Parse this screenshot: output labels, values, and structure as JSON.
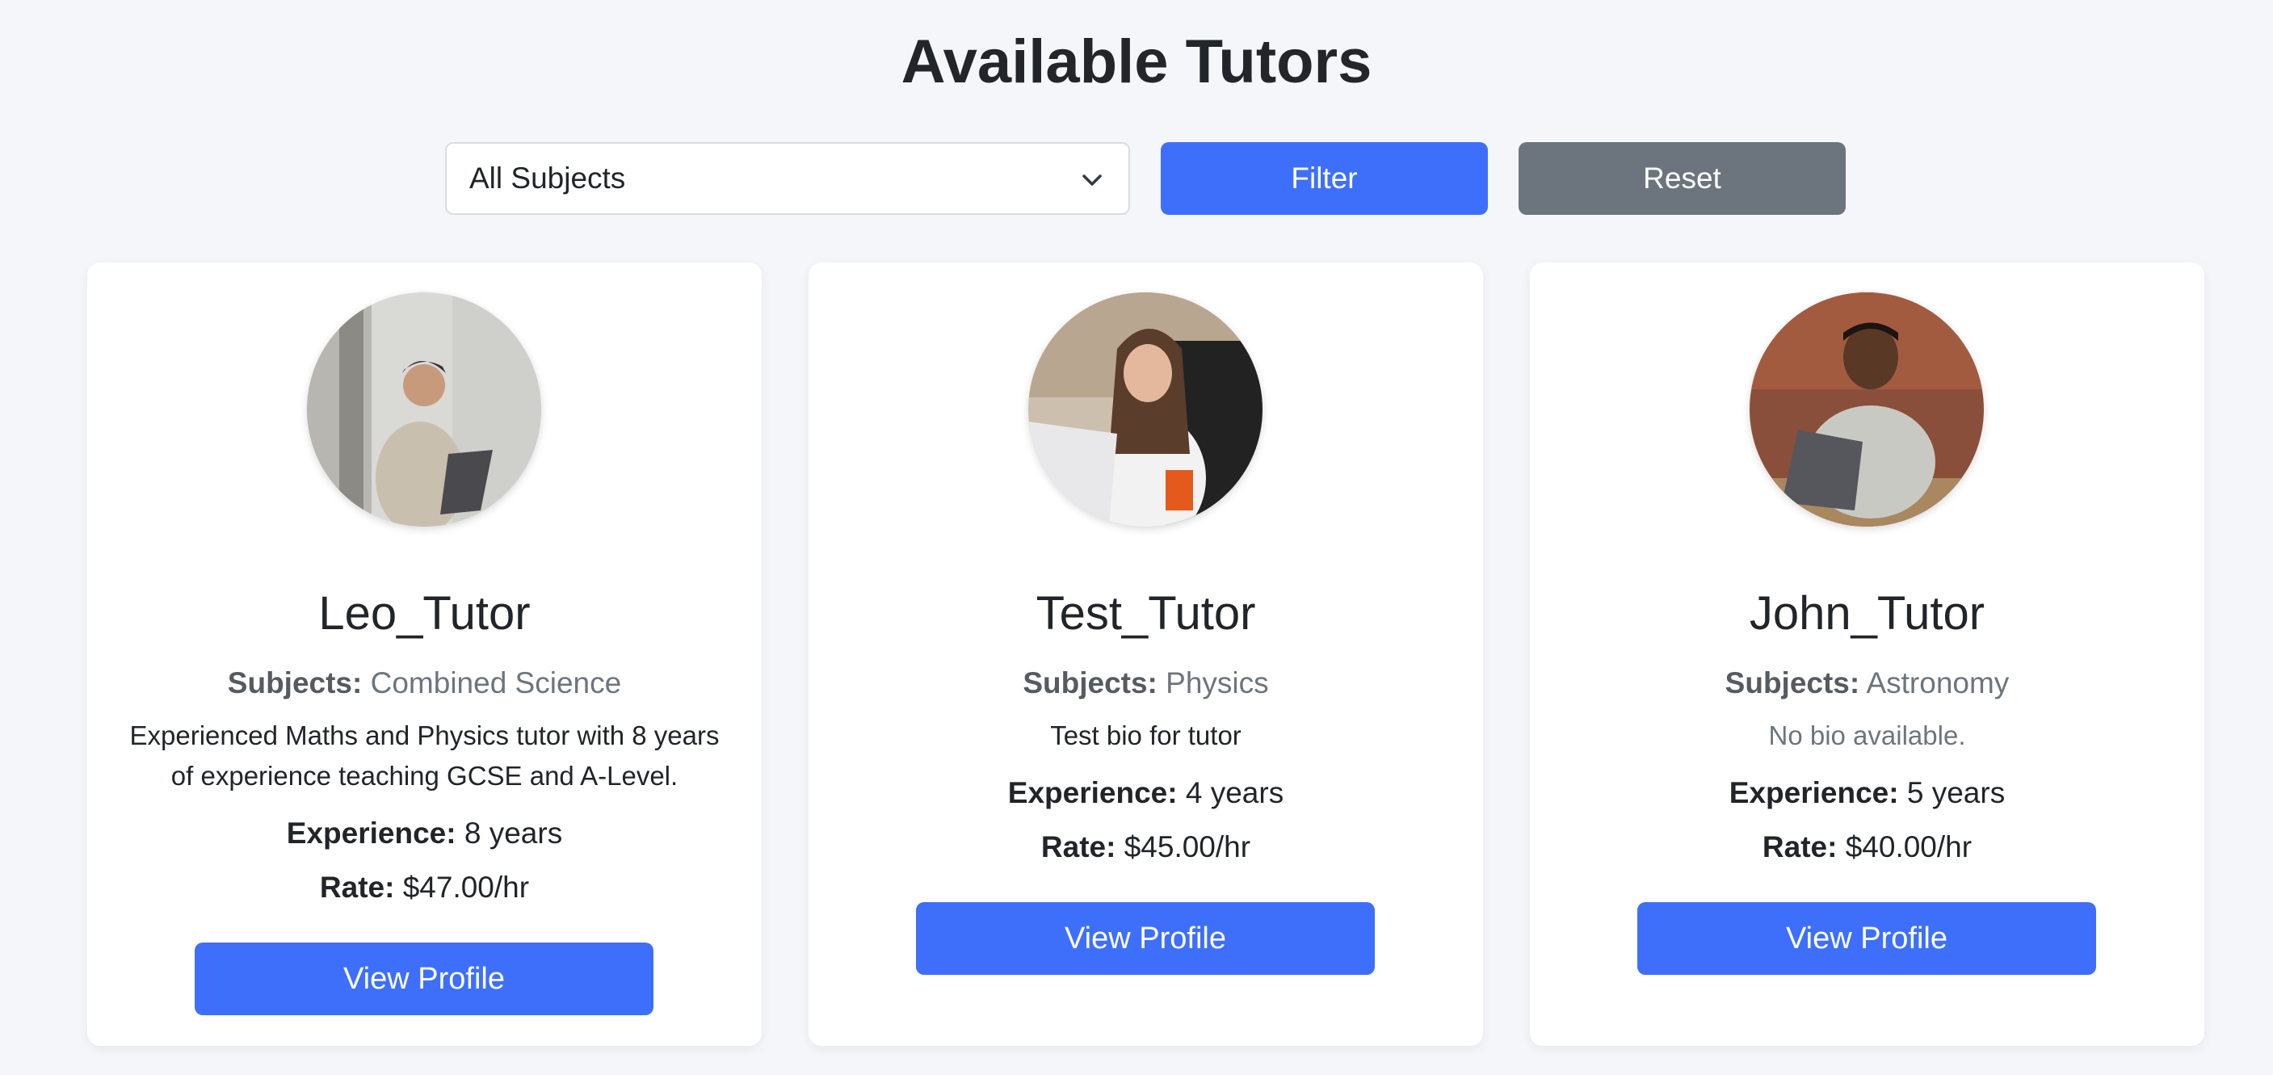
{
  "title": "Available Tutors",
  "filter": {
    "selected_subject": "All Subjects",
    "filter_label": "Filter",
    "reset_label": "Reset"
  },
  "labels": {
    "subjects": "Subjects:",
    "experience": "Experience:",
    "rate": "Rate:",
    "view_profile": "View Profile"
  },
  "tutors": [
    {
      "name": "Leo_Tutor",
      "subjects": "Combined Science",
      "bio": "Experienced Maths and Physics tutor with 8 years of experience teaching GCSE and A-Level.",
      "experience": "8 years",
      "rate": "$47.00/hr"
    },
    {
      "name": "Test_Tutor",
      "subjects": "Physics",
      "bio": "Test bio for tutor",
      "experience": "4 years",
      "rate": "$45.00/hr"
    },
    {
      "name": "John_Tutor",
      "subjects": "Astronomy",
      "bio": "No bio available.",
      "experience": "5 years",
      "rate": "$40.00/hr"
    }
  ],
  "colors": {
    "primary": "#3d6ffb",
    "secondary": "#6c757d",
    "background": "#f5f6fa"
  }
}
